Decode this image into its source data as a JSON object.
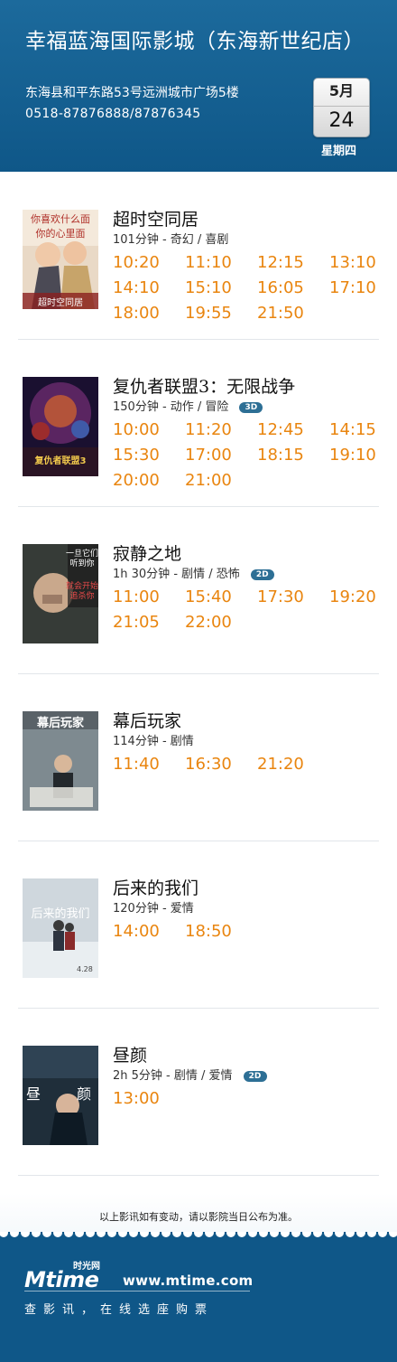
{
  "header": {
    "cinema_name": "幸福蓝海国际影城（东海新世纪店）",
    "address": "东海县和平东路53号远洲城市广场5楼",
    "phone": "0518-87876888/87876345",
    "calendar": {
      "month": "5月",
      "day": "24",
      "weekday": "星期四"
    }
  },
  "movies": [
    {
      "title": "超时空同居",
      "meta": "101分钟 - 奇幻 / 喜剧",
      "badge": "",
      "poster": {
        "text_top": "你喜欢什么面",
        "text_mid": "你的心里面",
        "text_bottom": "超时空同居"
      },
      "times": [
        "10:20",
        "11:10",
        "12:15",
        "13:10",
        "14:10",
        "15:10",
        "16:05",
        "17:10",
        "18:00",
        "19:55",
        "21:50"
      ]
    },
    {
      "title": "复仇者联盟3：无限战争",
      "meta": "150分钟 - 动作 / 冒险",
      "badge": "3D",
      "poster": {
        "text_top": "",
        "text_mid": "复仇者联盟3",
        "text_bottom": ""
      },
      "times": [
        "10:00",
        "11:20",
        "12:45",
        "14:15",
        "15:30",
        "17:00",
        "18:15",
        "19:10",
        "20:00",
        "21:00"
      ]
    },
    {
      "title": "寂静之地",
      "meta": "1h 30分钟 - 剧情 / 恐怖",
      "badge": "2D",
      "poster": {
        "text_top": "一旦它们听到你",
        "text_mid": "就会开始追杀你",
        "text_bottom": ""
      },
      "times": [
        "11:00",
        "15:40",
        "17:30",
        "19:20",
        "21:05",
        "22:00"
      ]
    },
    {
      "title": "幕后玩家",
      "meta": "114分钟 - 剧情",
      "badge": "",
      "poster": {
        "text_top": "幕后玩家",
        "text_mid": "",
        "text_bottom": ""
      },
      "times": [
        "11:40",
        "16:30",
        "21:20"
      ]
    },
    {
      "title": "后来的我们",
      "meta": "120分钟 - 爱情",
      "badge": "",
      "poster": {
        "text_top": "后来的我们",
        "text_mid": "",
        "text_bottom": "4.28"
      },
      "times": [
        "14:00",
        "18:50"
      ]
    },
    {
      "title": "昼颜",
      "meta": "2h 5分钟 - 剧情 / 爱情",
      "badge": "2D",
      "poster": {
        "text_top": "昼",
        "text_mid": "颜",
        "text_bottom": ""
      },
      "times": [
        "13:00"
      ]
    }
  ],
  "notice": "以上影讯如有变动，请以影院当日公布为准。",
  "footer": {
    "logo_text": "Mtime",
    "logo_cn": "时光网",
    "url": "www.mtime.com",
    "slogan": "查影讯，在线选座购票"
  },
  "colors": {
    "header_bg": "#0f5788",
    "showtime": "#e9850f",
    "badge_bg": "#2d6f95"
  }
}
